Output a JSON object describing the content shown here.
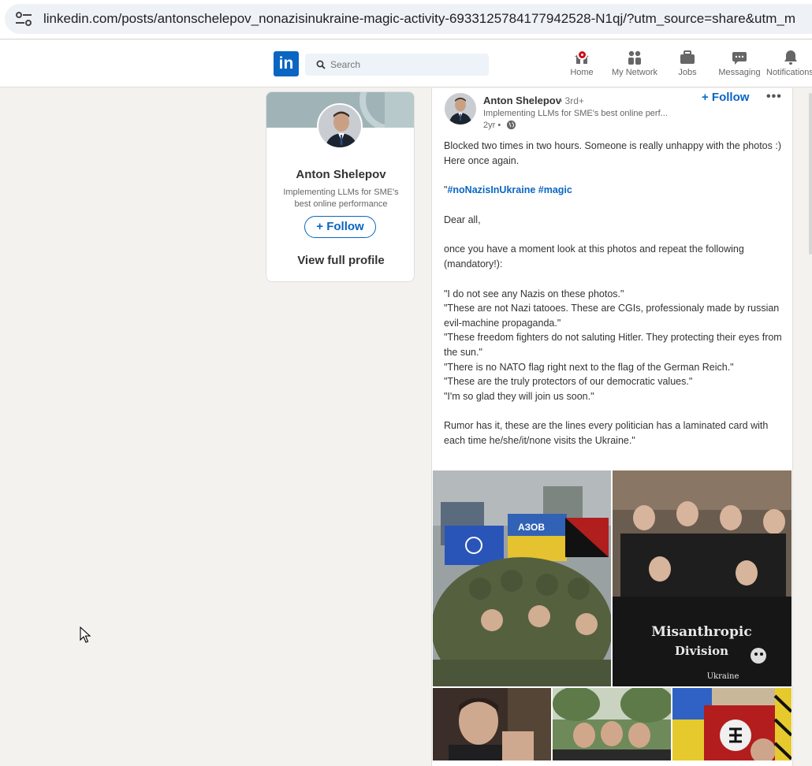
{
  "browser": {
    "url": "linkedin.com/posts/antonschelepov_nonazisinukraine-magic-activity-6933125784177942528-N1qj/?utm_source=share&utm_m"
  },
  "nav": {
    "logo_text": "in",
    "search_placeholder": "Search",
    "items": [
      {
        "label": "Home",
        "icon": "home-icon"
      },
      {
        "label": "My Network",
        "icon": "network-icon"
      },
      {
        "label": "Jobs",
        "icon": "briefcase-icon"
      },
      {
        "label": "Messaging",
        "icon": "messaging-icon"
      },
      {
        "label": "Notifications",
        "icon": "bell-icon"
      }
    ]
  },
  "profile_card": {
    "name": "Anton Shelepov",
    "headline": "Implementing LLMs for SME's best online performance",
    "follow_label": "+ Follow",
    "view_profile_label": "View full profile"
  },
  "post": {
    "author": "Anton Shelepov",
    "degree": "• 3rd+",
    "headline": "Implementing LLMs for SME's best online perf...",
    "time": "2yr •",
    "follow_label": "+ Follow",
    "more_label": "•••",
    "body": {
      "p1": "Blocked two times in two hours. Someone is really unhappy with the photos :)\nHere once again.",
      "quote_mark": "\"",
      "tag1": "#noNazisInUkraine",
      "tag2": "#magic",
      "greeting": "Dear all,",
      "p2": "once you have a moment look at this photos and repeat the following (mandatory!):",
      "quotes": [
        "\"I do not see any Nazis on these photos.\"",
        "\"These are not Nazi tatooes. These are CGIs, professionaly made by russian evil-machine propaganda.\"",
        "\"These freedom fighters do not saluting Hitler. They protecting their eyes from the sun.\"",
        "\"There is no NATO flag right next to the flag of the German Reich.\"",
        "\"These are the truly protectors of our democratic values.\"",
        "\"I'm so glad they will join us soon.\""
      ],
      "p3": "Rumor has it, these are the lines every politician has a laminated card with each time he/she/it/none visits the Ukraine.\""
    },
    "photo_texts": {
      "flag_text": "АЗОВ",
      "banner_line1": "Misanthropic",
      "banner_line2": "Division",
      "banner_line3": "Ukraine"
    }
  },
  "colors": {
    "brand": "#0a66c2",
    "badge": "#cc1016",
    "bg": "#f3f2ef"
  }
}
